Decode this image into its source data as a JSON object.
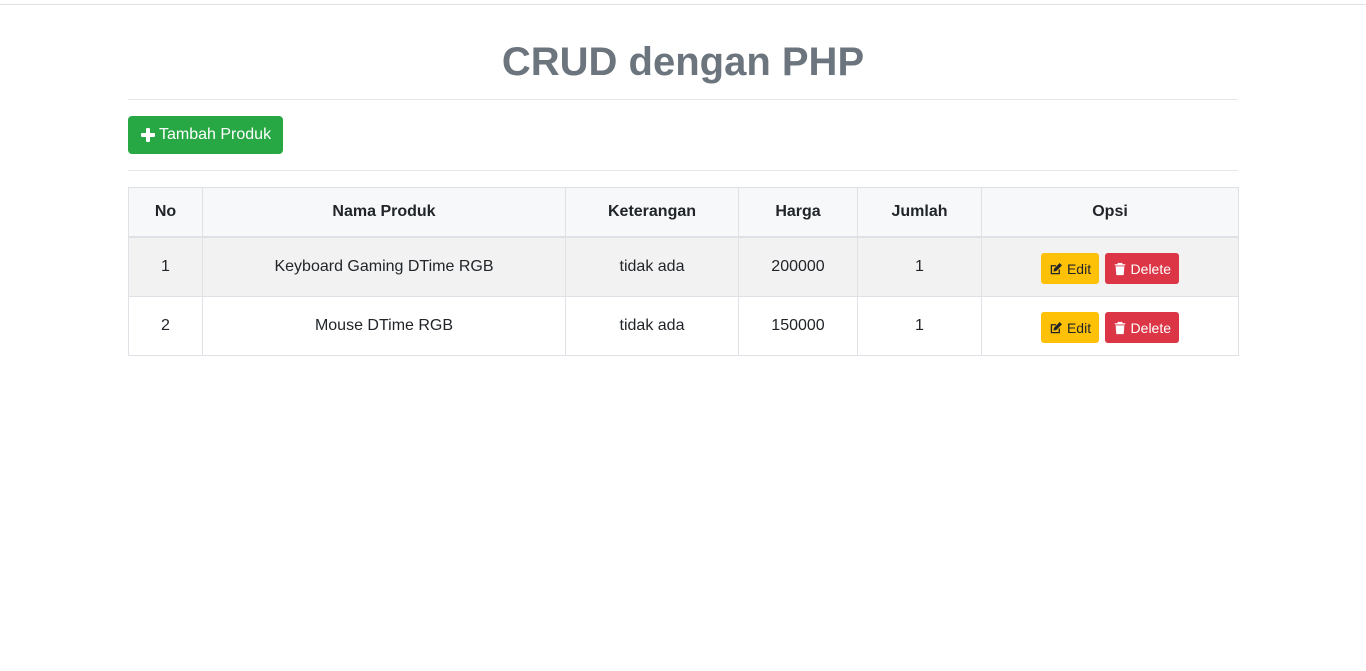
{
  "header": {
    "title": "CRUD dengan PHP"
  },
  "toolbar": {
    "add_label": "Tambah Produk",
    "add_icon": "plus-icon"
  },
  "table": {
    "columns": [
      "No",
      "Nama Produk",
      "Keterangan",
      "Harga",
      "Jumlah",
      "Opsi"
    ],
    "rows": [
      {
        "no": "1",
        "nama": "Keyboard Gaming DTime RGB",
        "keterangan": "tidak ada",
        "harga": "200000",
        "jumlah": "1"
      },
      {
        "no": "2",
        "nama": "Mouse DTime RGB",
        "keterangan": "tidak ada",
        "harga": "150000",
        "jumlah": "1"
      }
    ],
    "actions": {
      "edit_label": "Edit",
      "edit_icon": "edit-icon",
      "delete_label": "Delete",
      "delete_icon": "trash-icon"
    }
  },
  "colors": {
    "add_button": "#28a745",
    "edit_button": "#ffc107",
    "delete_button": "#dc3545",
    "title": "#6c757d"
  }
}
